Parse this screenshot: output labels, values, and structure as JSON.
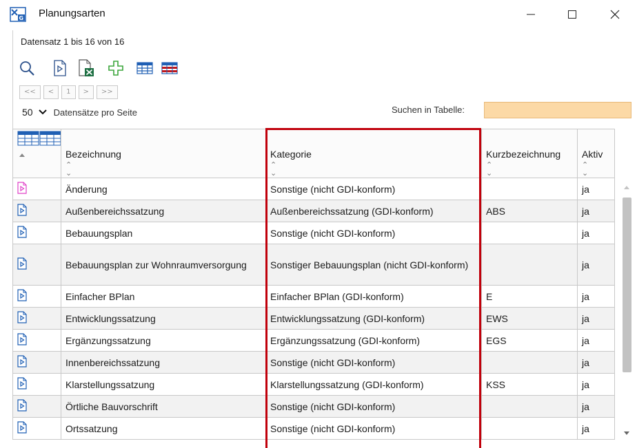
{
  "window": {
    "title": "Planungsarten",
    "icon": "xplan-grid-icon",
    "controls": [
      "minimize-icon",
      "maximize-icon",
      "close-icon"
    ]
  },
  "record_info": "Datensatz 1 bis 16 von 16",
  "toolbar": {
    "icons": [
      "search-icon",
      "open-record-icon",
      "excel-export-icon",
      "add-icon",
      "table-view-icon",
      "table-layout-icon"
    ],
    "colors": {
      "add": "#3aa53a",
      "table_blue": "#1f5fb4",
      "table_red": "#c0171c",
      "excel": "#1d6f42"
    }
  },
  "pager": {
    "first": "<<",
    "prev": "<",
    "page": "1",
    "next": ">",
    "last": ">>"
  },
  "per_page": {
    "value": "50",
    "label": "Datensätze pro Seite"
  },
  "search": {
    "label": "Suchen in Tabelle:",
    "value": "",
    "background": "#fcd9a6"
  },
  "table": {
    "columns": [
      "Bezeichnung",
      "Kategorie",
      "Kurzbezeichnung",
      "Aktiv"
    ],
    "rows": [
      {
        "bezeichnung": "Änderung",
        "kategorie": "Sonstige (nicht GDI-konform)",
        "kurz": "",
        "aktiv": "ja",
        "icon_color": "#e040c8"
      },
      {
        "bezeichnung": "Außenbereichssatzung",
        "kategorie": "Außenbereichssatzung (GDI-konform)",
        "kurz": "ABS",
        "aktiv": "ja",
        "icon_color": "#1f5fb4"
      },
      {
        "bezeichnung": "Bebauungsplan",
        "kategorie": "Sonstige (nicht GDI-konform)",
        "kurz": "",
        "aktiv": "ja",
        "icon_color": "#1f5fb4"
      },
      {
        "bezeichnung": "Bebauungsplan zur Wohnraumversorgung",
        "kategorie": "Sonstiger Bebauungsplan (nicht GDI-konform)",
        "kurz": "",
        "aktiv": "ja",
        "icon_color": "#1f5fb4"
      },
      {
        "bezeichnung": "Einfacher BPlan",
        "kategorie": "Einfacher BPlan (GDI-konform)",
        "kurz": "E",
        "aktiv": "ja",
        "icon_color": "#1f5fb4"
      },
      {
        "bezeichnung": "Entwicklungssatzung",
        "kategorie": "Entwicklungssatzung (GDI-konform)",
        "kurz": "EWS",
        "aktiv": "ja",
        "icon_color": "#1f5fb4"
      },
      {
        "bezeichnung": "Ergänzungssatzung",
        "kategorie": "Ergänzungssatzung (GDI-konform)",
        "kurz": "EGS",
        "aktiv": "ja",
        "icon_color": "#1f5fb4"
      },
      {
        "bezeichnung": "Innenbereichssatzung",
        "kategorie": "Sonstige (nicht GDI-konform)",
        "kurz": "",
        "aktiv": "ja",
        "icon_color": "#1f5fb4"
      },
      {
        "bezeichnung": "Klarstellungssatzung",
        "kategorie": "Klarstellungssatzung (GDI-konform)",
        "kurz": "KSS",
        "aktiv": "ja",
        "icon_color": "#1f5fb4"
      },
      {
        "bezeichnung": "Örtliche Bauvorschrift",
        "kategorie": "Sonstige (nicht GDI-konform)",
        "kurz": "",
        "aktiv": "ja",
        "icon_color": "#1f5fb4"
      },
      {
        "bezeichnung": "Ortssatzung",
        "kategorie": "Sonstige (nicht GDI-konform)",
        "kurz": "",
        "aktiv": "ja",
        "icon_color": "#1f5fb4"
      }
    ]
  },
  "highlight_color": "#c0000b"
}
